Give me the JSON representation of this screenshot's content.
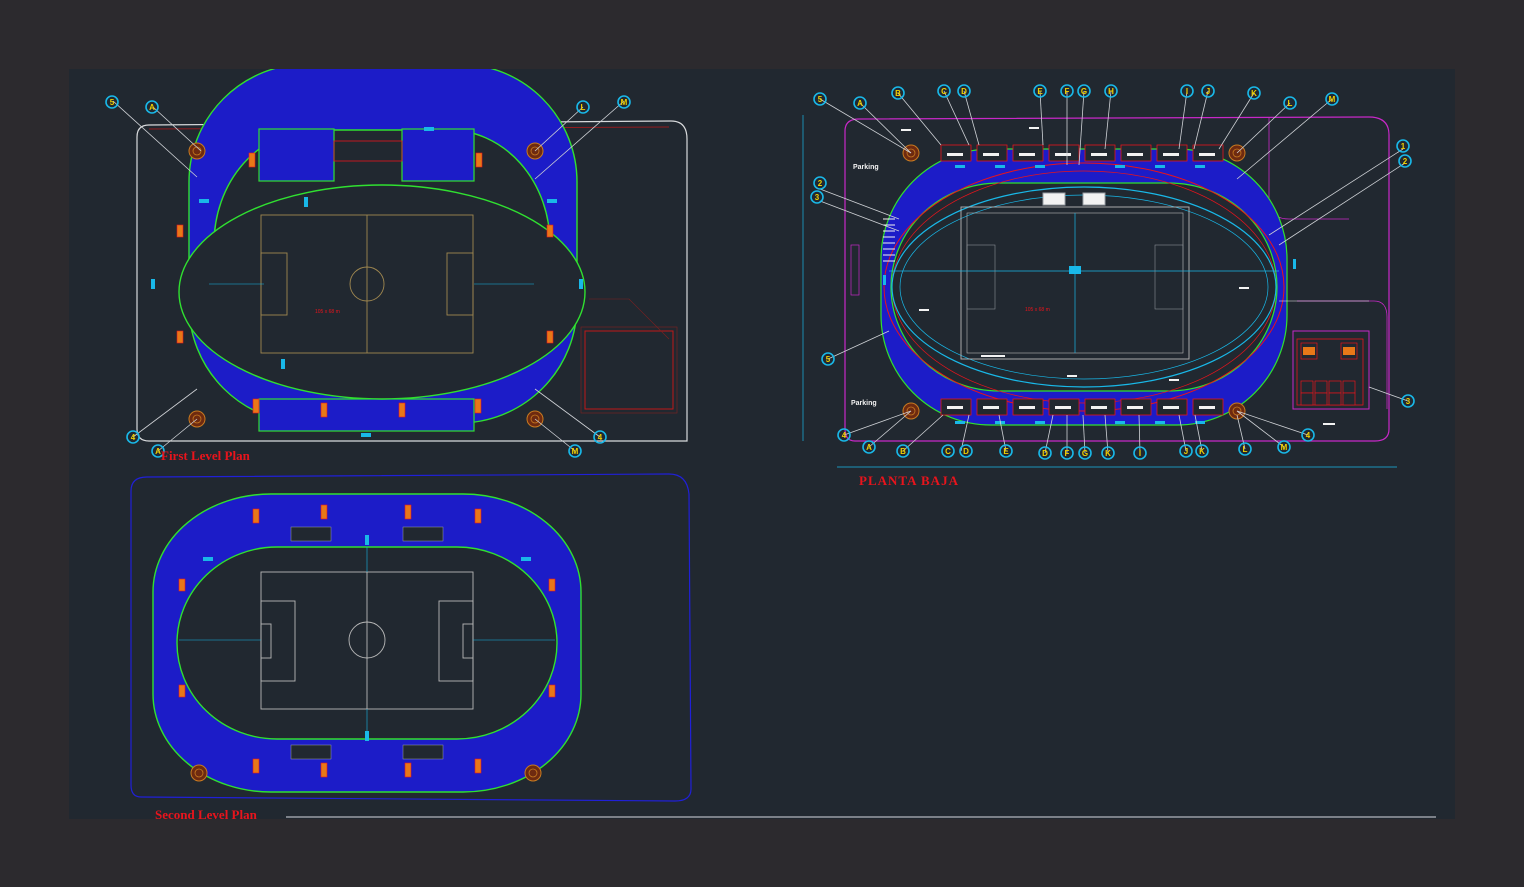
{
  "drawing": {
    "background": "#212830",
    "frame_color": "#2c2a2e",
    "colors": {
      "stand_fill": "#1c1cc8",
      "stand_outline": "#30e030",
      "boundary": "#d8dadc",
      "site_boundary_second": "#2020d8",
      "site_boundary_ground": "#c828c8",
      "pitch_lines": "#b8b8b8",
      "pitch_lines_first": "#a08850",
      "cyan": "#19b8e8",
      "red": "#e8141c",
      "bubble_text": "#f0d000"
    }
  },
  "plans": {
    "first": {
      "title": "First Level Plan",
      "bubbles": [
        "5",
        "A",
        "L",
        "M",
        "4",
        "A",
        "M",
        "4"
      ]
    },
    "second": {
      "title": "Second Level Plan"
    },
    "ground": {
      "title": "PLANTA BAJA",
      "parking_top": "Parking",
      "parking_bottom": "Parking",
      "top_bubbles": [
        "5",
        "A",
        "B",
        "C",
        "D",
        "E",
        "F",
        "G",
        "H",
        "I",
        "J",
        "K",
        "L",
        "M"
      ],
      "bottom_bubbles": [
        "4",
        "A",
        "B",
        "C",
        "D",
        "E",
        "D",
        "F",
        "G",
        "K",
        "I",
        "J",
        "K",
        "L",
        "M",
        "4"
      ],
      "left_bubbles": [
        "2",
        "3",
        "5"
      ],
      "right_bubbles": [
        "1",
        "2",
        "3"
      ]
    }
  },
  "icons": {
    "grid_bubble": "grid-bubble-icon",
    "tree": "tree-symbol-icon"
  }
}
